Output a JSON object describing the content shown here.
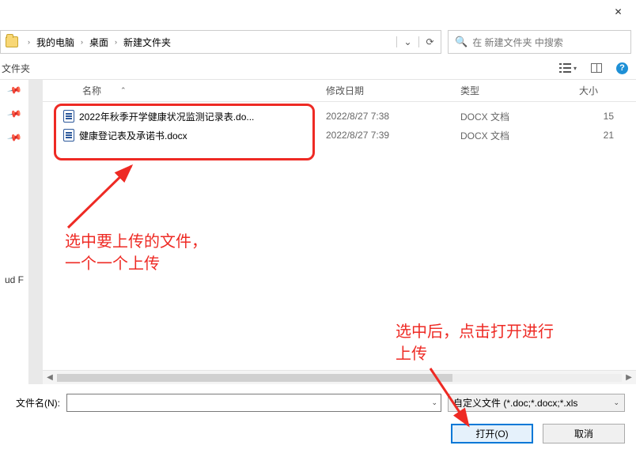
{
  "titlebar": {
    "close_symbol": "✕"
  },
  "address": {
    "crumbs": [
      "我的电脑",
      "桌面",
      "新建文件夹"
    ],
    "dropdown_symbol": "⌄",
    "refresh_symbol": "⟳"
  },
  "search": {
    "icon": "🔍",
    "placeholder": "在 新建文件夹 中搜索"
  },
  "row2": {
    "left_label": "文件夹",
    "help_symbol": "?"
  },
  "left_rail": {
    "pin_symbol": "📌",
    "label": "ud F"
  },
  "columns": {
    "checkbox_pad": "",
    "name": "名称",
    "date": "修改日期",
    "type": "类型",
    "size": "大小",
    "sort_indicator": "⌃"
  },
  "files": [
    {
      "name": "2022年秋季开学健康状况监测记录表.do...",
      "date": "2022/8/27 7:38",
      "type": "DOCX 文档",
      "size": "15"
    },
    {
      "name": "健康登记表及承诺书.docx",
      "date": "2022/8/27 7:39",
      "type": "DOCX 文档",
      "size": "21"
    }
  ],
  "annotations": {
    "a1": "选中要上传的文件，\n一个一个上传",
    "a2": "选中后，点击打开进行\n上传"
  },
  "footer": {
    "filename_label": "文件名(N):",
    "filter_label": "自定义文件 (*.doc;*.docx;*.xls",
    "open_label": "打开(O)",
    "cancel_label": "取消"
  }
}
